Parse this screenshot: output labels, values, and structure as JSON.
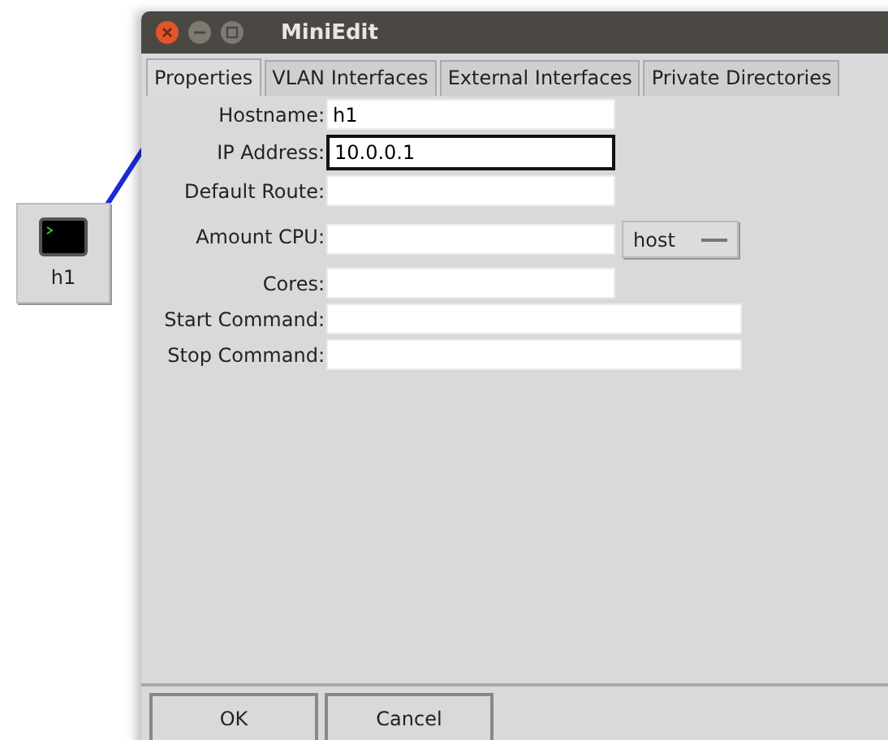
{
  "canvas": {
    "node": {
      "label": "h1"
    }
  },
  "window": {
    "title": "MiniEdit"
  },
  "tabs": [
    {
      "label": "Properties",
      "selected": true
    },
    {
      "label": "VLAN Interfaces",
      "selected": false
    },
    {
      "label": "External Interfaces",
      "selected": false
    },
    {
      "label": "Private Directories",
      "selected": false
    }
  ],
  "fields": [
    {
      "label": "Hostname:",
      "value": "h1",
      "kind": "short",
      "focused": false
    },
    {
      "label": "IP Address:",
      "value": "10.0.0.1",
      "kind": "short",
      "focused": true
    },
    {
      "label": "Default Route:",
      "kind": "short",
      "focused": false
    },
    {
      "label": "Amount CPU:",
      "kind": "short",
      "focused": false,
      "dropdown": "host"
    },
    {
      "label": "Cores:",
      "kind": "short",
      "focused": false
    },
    {
      "label": "Start Command:",
      "kind": "long",
      "focused": false
    },
    {
      "label": "Stop Command:",
      "kind": "long",
      "focused": false
    }
  ],
  "buttons": [
    "OK",
    "Cancel"
  ]
}
